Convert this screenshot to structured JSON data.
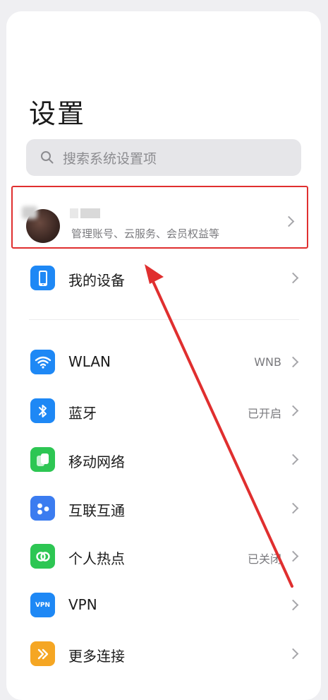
{
  "page": {
    "title": "设置"
  },
  "search": {
    "placeholder": "搜索系统设置项"
  },
  "account": {
    "subtitle": "管理账号、云服务、会员权益等"
  },
  "my_device": {
    "label": "我的设备"
  },
  "items": [
    {
      "label": "WLAN",
      "value": "WNB",
      "icon": "wifi-icon",
      "color": "#1e88f5"
    },
    {
      "label": "蓝牙",
      "value": "已开启",
      "icon": "bluetooth-icon",
      "color": "#1e88f5"
    },
    {
      "label": "移动网络",
      "value": "",
      "icon": "mobile-network-icon",
      "color": "#2dc653"
    },
    {
      "label": "互联互通",
      "value": "",
      "icon": "interconnect-icon",
      "color": "#3b7cf0"
    },
    {
      "label": "个人热点",
      "value": "已关闭",
      "icon": "hotspot-icon",
      "color": "#2dc653"
    },
    {
      "label": "VPN",
      "value": "",
      "icon": "vpn-icon",
      "color": "#1e88f5"
    },
    {
      "label": "更多连接",
      "value": "",
      "icon": "more-connections-icon",
      "color": "#f5a623"
    }
  ],
  "vpn_icon_text": "VPN",
  "colors": {
    "annotation": "#e02f2f",
    "background": "#efeff2",
    "card": "#ffffff"
  }
}
